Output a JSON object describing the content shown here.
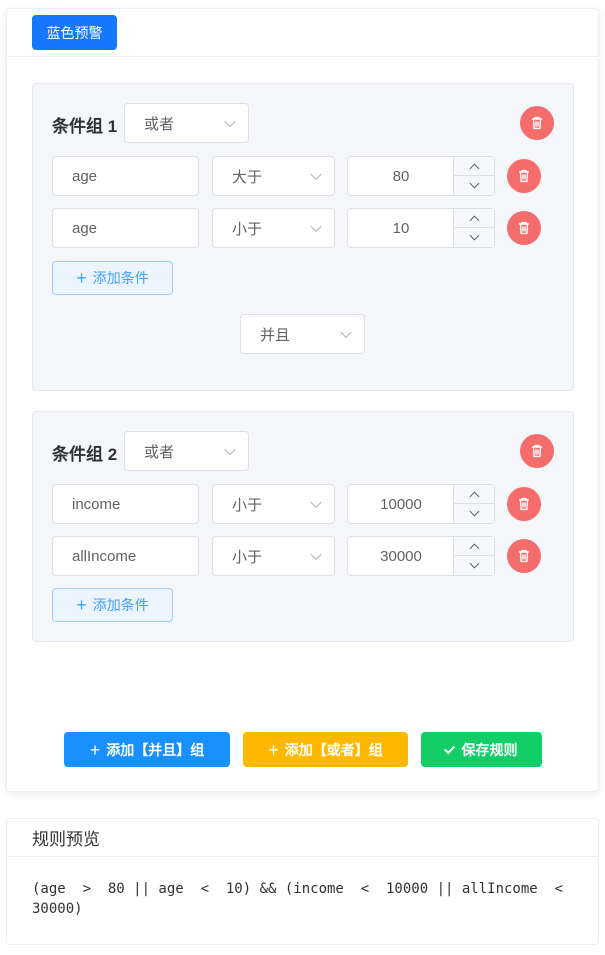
{
  "header": {
    "tag_label": "蓝色预警"
  },
  "groups": [
    {
      "title": "条件组 1",
      "logic": "或者",
      "conditions": [
        {
          "field": "age",
          "operator": "大于",
          "value": "80"
        },
        {
          "field": "age",
          "operator": "小于",
          "value": "10"
        }
      ],
      "add_condition_label": "添加条件",
      "joiner": "并且"
    },
    {
      "title": "条件组 2",
      "logic": "或者",
      "conditions": [
        {
          "field": "income",
          "operator": "小于",
          "value": "10000"
        },
        {
          "field": "allIncome",
          "operator": "小于",
          "value": "30000"
        }
      ],
      "add_condition_label": "添加条件"
    }
  ],
  "actions": {
    "add_and_group": "添加【并且】组",
    "add_or_group": "添加【或者】组",
    "save_rule": "保存规则"
  },
  "preview": {
    "title": "规则预览",
    "text": "(age  >  80 || age  <  10) && (income  <  10000 || allIncome  <  30000)"
  },
  "colors": {
    "tag": "#1677ff",
    "add_and": "#1890ff",
    "add_or": "#ffb800",
    "save": "#13ce66",
    "delete": "#f56c6c",
    "link": "#409eff"
  },
  "icons": {
    "delete": "trash-icon",
    "add": "plus-icon",
    "save": "check-icon",
    "dropdown": "chevron-down-icon",
    "stepper_up": "chevron-up-icon",
    "stepper_down": "chevron-down-icon"
  }
}
